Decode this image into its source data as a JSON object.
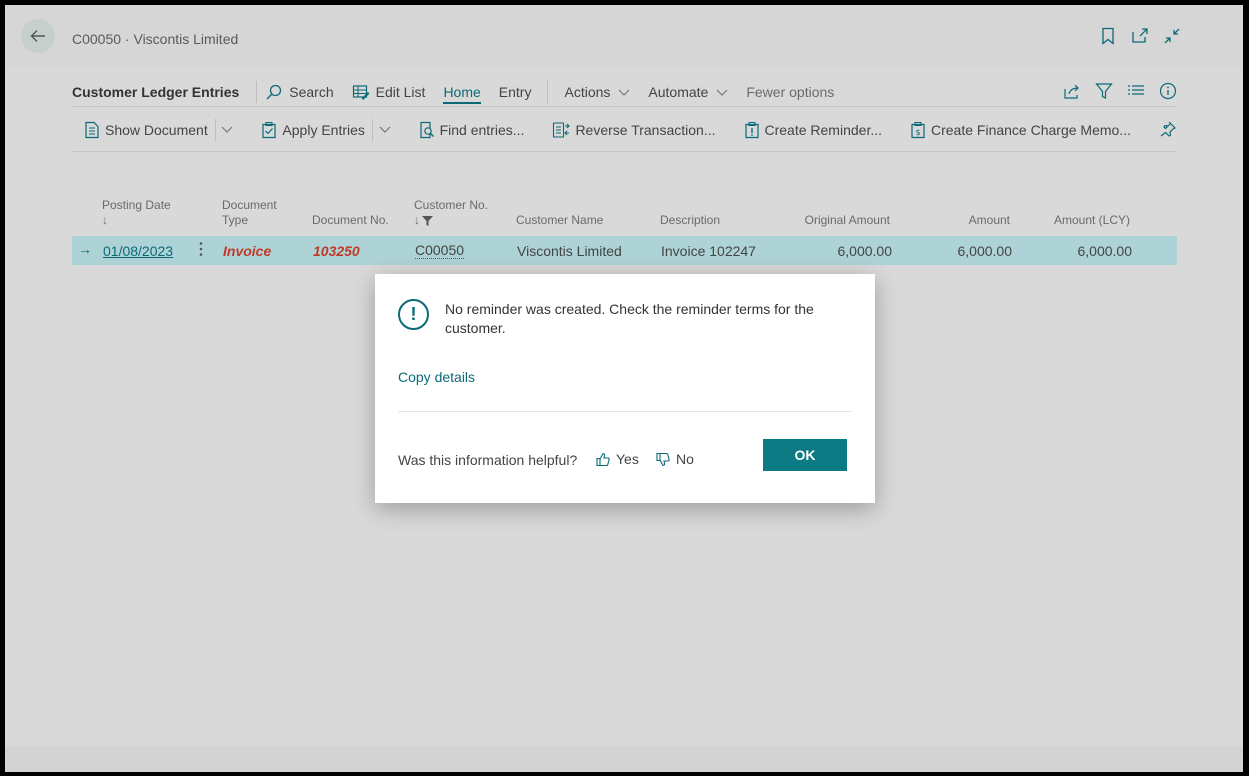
{
  "window": {
    "title": "C00050 · Viscontis Limited"
  },
  "actionbar": {
    "page_name": "Customer Ledger Entries",
    "search": "Search",
    "edit_list": "Edit List",
    "home": "Home",
    "entry": "Entry",
    "actions": "Actions",
    "automate": "Automate",
    "fewer_options": "Fewer options"
  },
  "promoted": {
    "show_document": "Show Document",
    "apply_entries": "Apply Entries",
    "find_entries": "Find entries...",
    "reverse_transaction": "Reverse Transaction...",
    "create_reminder": "Create Reminder...",
    "create_finance_charge": "Create Finance Charge Memo..."
  },
  "table": {
    "headers": {
      "posting_date": "Posting Date",
      "document_type_1": "Document",
      "document_type_2": "Type",
      "document_no": "Document No.",
      "customer_no": "Customer No.",
      "customer_name": "Customer Name",
      "description": "Description",
      "original_amount": "Original Amount",
      "amount": "Amount",
      "amount_lcy": "Amount (LCY)"
    },
    "row": {
      "posting_date": "01/08/2023",
      "document_type": "Invoice",
      "document_no": "103250",
      "customer_no": "C00050",
      "customer_name": "Viscontis Limited",
      "description": "Invoice 102247",
      "original_amount": "6,000.00",
      "amount": "6,000.00",
      "amount_lcy": "6,000.00"
    }
  },
  "dialog": {
    "message": "No reminder was created. Check the reminder terms for the customer.",
    "copy_details": "Copy details",
    "helpful_question": "Was this information helpful?",
    "yes": "Yes",
    "no": "No",
    "ok": "OK"
  },
  "colors": {
    "accent": "#0b6a78",
    "selected_row": "#aed3d6",
    "error_text": "#c0392b"
  }
}
